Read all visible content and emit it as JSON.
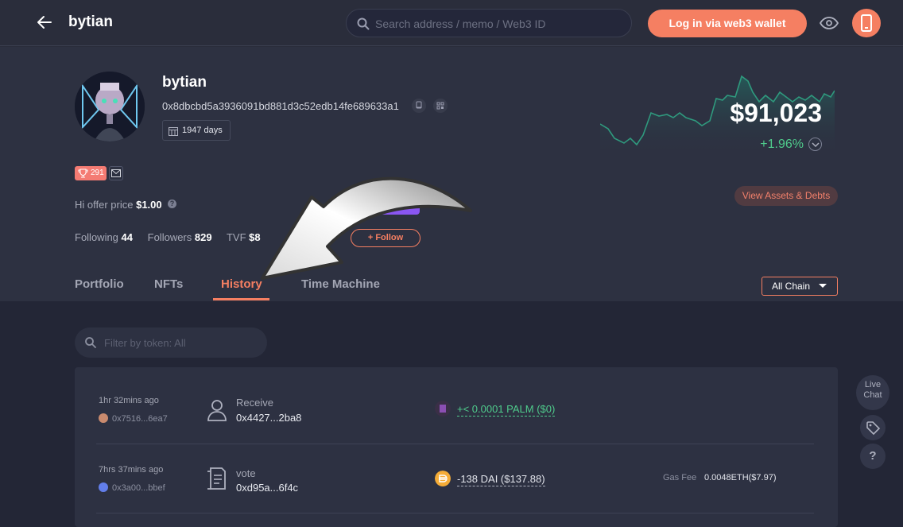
{
  "topbar": {
    "title": "bytian",
    "search_placeholder": "Search address / memo / Web3 ID",
    "login_label": "Log in via web3 wallet"
  },
  "profile": {
    "name": "bytian",
    "address": "0x8dbcbd5a3936091bd881d3c52edb14fe689633a1",
    "days": "1947 days",
    "badge_count": "291",
    "offer_label": "Hi offer price",
    "offer_value": "$1.00",
    "hi_label": "Hi",
    "following_label": "Following",
    "following_count": "44",
    "followers_label": "Followers",
    "followers_count": "829",
    "tvf_label": "TVF",
    "tvf_value": "$8",
    "follow_label": "+ Follow"
  },
  "networth": {
    "value": "$91,023",
    "change": "+1.96%",
    "assets_button": "View Assets & Debts"
  },
  "tabs": [
    "Portfolio",
    "NFTs",
    "History",
    "Time Machine"
  ],
  "active_tab": "History",
  "chain_select": "All Chain",
  "filter_placeholder": "Filter by token: All",
  "history": [
    {
      "time": "1hr 32mins ago",
      "source": "0x7516...6ea7",
      "type": "Receive",
      "hash": "0x4427...2ba8",
      "amount": "+< 0.0001 PALM  ($0)",
      "gas_label": "",
      "gas_value": ""
    },
    {
      "time": "7hrs 37mins ago",
      "source": "0x3a00...bbef",
      "type": "vote",
      "hash": "0xd95a...6f4c",
      "amount": "-138 DAI  ($137.88)",
      "gas_label": "Gas Fee",
      "gas_value": "0.0048ETH($7.97)"
    }
  ],
  "side": {
    "live_chat": "Live Chat",
    "help": "?"
  },
  "colors": {
    "accent": "#f57f62",
    "positive": "#4fcc8c",
    "purple": "#8a56f2"
  },
  "icons": [
    "back-arrow-icon",
    "search-icon",
    "eye-icon",
    "phone-icon",
    "copy-icon",
    "qr-code-icon",
    "calendar-icon",
    "trophy-icon",
    "mail-icon",
    "help-icon",
    "chevron-down-icon",
    "user-icon",
    "document-icon",
    "palm-token-icon",
    "dai-token-icon",
    "tag-icon",
    "curved-arrow-icon"
  ]
}
